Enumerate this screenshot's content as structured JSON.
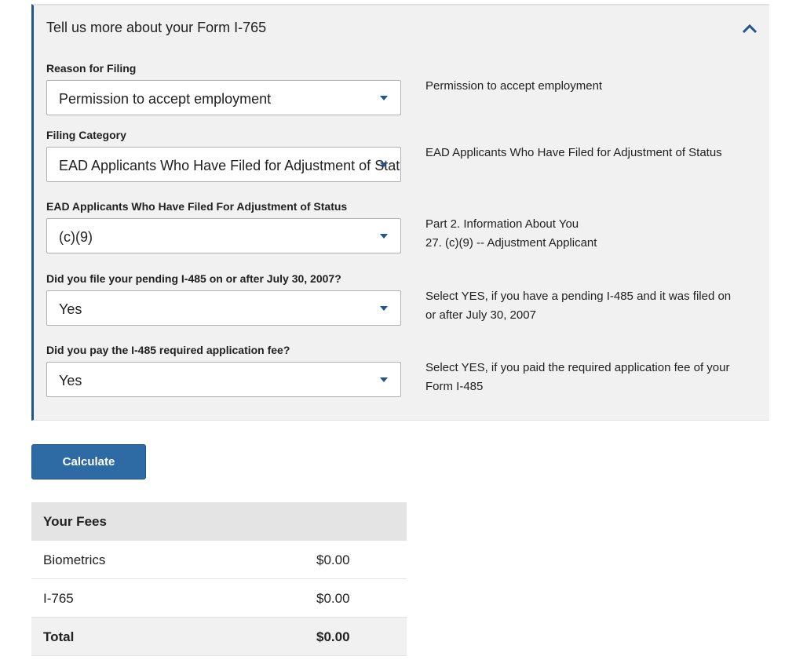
{
  "panel": {
    "title": "Tell us more about your Form I-765",
    "fields": [
      {
        "label": "Reason for Filing",
        "value": "Permission to accept employment",
        "help": "Permission to accept employment"
      },
      {
        "label": "Filing Category",
        "value": "EAD Applicants Who Have Filed for Adjustment of Status",
        "help": "EAD Applicants Who Have Filed for Adjustment of Status"
      },
      {
        "label": "EAD Applicants Who Have Filed For Adjustment of Status",
        "value": "(c)(9)",
        "help_line1": "Part 2. Information About You",
        "help_line2": "27. (c)(9) -- Adjustment Applicant"
      },
      {
        "label": "Did you file your pending I-485 on or after July 30, 2007?",
        "value": "Yes",
        "help": "Select YES, if you have a pending I-485 and it was filed on or after July 30, 2007"
      },
      {
        "label": "Did you pay the I-485 required application fee?",
        "value": "Yes",
        "help": "Select YES, if you paid the required application fee of your Form I-485"
      }
    ]
  },
  "calculate_label": "Calculate",
  "fees": {
    "title": "Your Fees",
    "rows": [
      {
        "name": "Biometrics",
        "amount": "$0.00"
      },
      {
        "name": "I-765",
        "amount": "$0.00"
      }
    ],
    "total": {
      "name": "Total",
      "amount": "$0.00"
    }
  },
  "colors": {
    "accent": "#205493",
    "button": "#2e6aa3",
    "panel_bg": "#f1f1f1"
  },
  "icons": {
    "collapse": "chevron-up-icon",
    "dropdown": "dropdown-caret-icon"
  }
}
